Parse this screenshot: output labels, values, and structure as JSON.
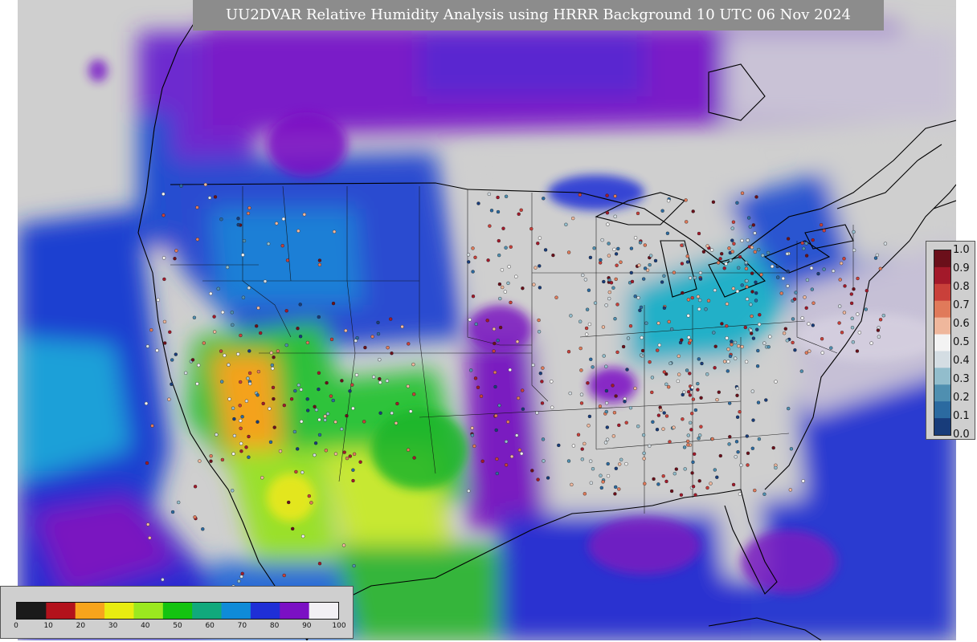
{
  "title": "UU2DVAR Relative Humidity Analysis using HRRR Background 10 UTC 06 Nov 2024",
  "colorbar": {
    "ticks": [
      "0",
      "10",
      "20",
      "30",
      "40",
      "50",
      "60",
      "70",
      "80",
      "90",
      "100"
    ],
    "colors": [
      "#1a1a1a",
      "#b3121c",
      "#f7a41c",
      "#e8ec10",
      "#9be81f",
      "#14c310",
      "#11a97c",
      "#0f8bd8",
      "#1f2fd6",
      "#7b10c4",
      "#f2f0f4"
    ]
  },
  "obs_scale": {
    "ticks": [
      "1.0",
      "0.9",
      "0.8",
      "0.7",
      "0.6",
      "0.5",
      "0.4",
      "0.3",
      "0.2",
      "0.1",
      "0.0"
    ],
    "colors": [
      "#6b0f1a",
      "#a3192a",
      "#c9403a",
      "#e07a5a",
      "#efb79c",
      "#f3f3f3",
      "#d4dde3",
      "#92bdcc",
      "#4f8fb0",
      "#2b6aa0",
      "#183c7a"
    ]
  }
}
